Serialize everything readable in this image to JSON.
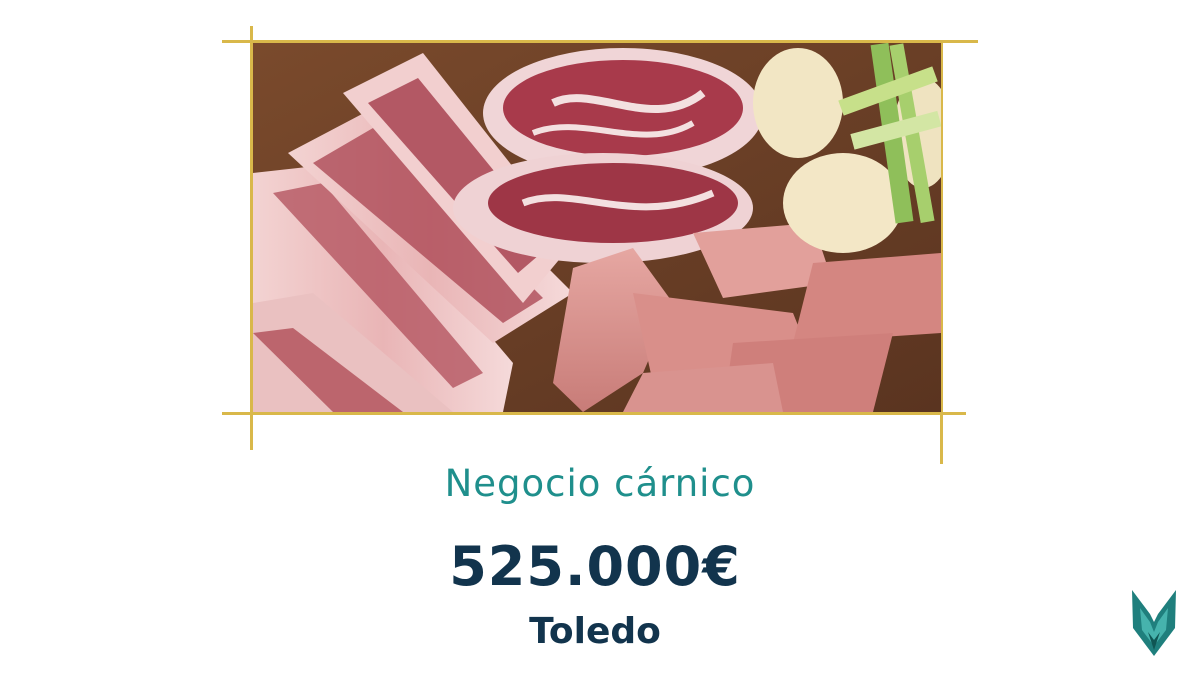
{
  "listing": {
    "title": "Negocio cárnico",
    "price": "525.000€",
    "location": "Toledo"
  },
  "image": {
    "subject": "raw-meat-cuts-photo"
  },
  "colors": {
    "accent_gold": "#d9b84a",
    "title_teal": "#1f8f8c",
    "text_navy": "#12344d",
    "logo_teal": "#1f7f7d"
  },
  "logo": {
    "icon": "fox-logo-icon"
  }
}
